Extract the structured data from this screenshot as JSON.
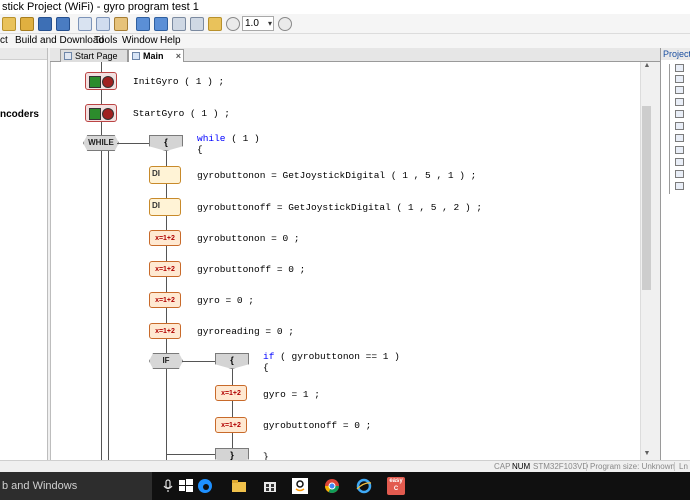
{
  "window": {
    "title": "stick Project (WiFi) - gyro program test 1"
  },
  "toolbar": {
    "zoom_value": "1.0",
    "dropdown_glyph": "▾"
  },
  "menu": {
    "items": [
      "ct",
      "Build and Download",
      "Tools",
      "Window",
      "Help"
    ]
  },
  "left_panel": {
    "label": "ncoders"
  },
  "tabs": [
    {
      "label": "Start Page",
      "active": false
    },
    {
      "label": "Main",
      "active": true,
      "close": "×"
    }
  ],
  "right_panel": {
    "header": "Project E"
  },
  "program": {
    "lines": {
      "init_gyro": "InitGyro ( 1 ) ;",
      "start_gyro": "StartGyro ( 1 ) ;",
      "while_kw": "while",
      "while_rest": " ( 1 )",
      "open_brace_1": "{",
      "l1": "gyrobuttonon = GetJoystickDigital ( 1 , 5 , 1 ) ;",
      "l2": "gyrobuttonoff = GetJoystickDigital ( 1 , 5 , 2 ) ;",
      "l3": "gyrobuttonon = 0 ;",
      "l4": "gyrobuttonoff = 0 ;",
      "l5": "gyro = 0 ;",
      "l6": "gyroreading = 0 ;",
      "if_kw": "if",
      "if_rest": " ( gyrobuttonon == 1 )",
      "open_brace_2": "{",
      "l7": "gyro = 1 ;",
      "l8": "gyrobuttonoff = 0 ;",
      "close_brace": "}"
    },
    "blocks": {
      "while_label": "WHILE",
      "if_label": "IF",
      "brace_label": "{",
      "close_label": "}",
      "din_label": "DI",
      "assign_label": "x=1+2"
    }
  },
  "status": {
    "cap": "CAP",
    "num": "NUM",
    "device": "STM32F103VD",
    "program_size": "Program size: Unknown",
    "line": "Ln"
  },
  "taskbar": {
    "search_text": "b and Windows",
    "easyc_label": "easy C"
  },
  "colors": {
    "keyword": "#0000ff",
    "assign_text": "#b00000",
    "taskbar_bg": "#101010"
  }
}
